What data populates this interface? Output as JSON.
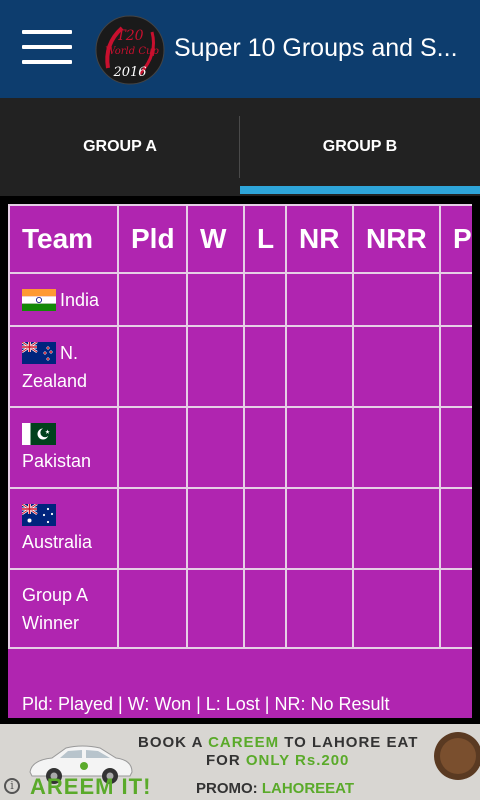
{
  "app_bar": {
    "title": "Super 10 Groups and S...",
    "logo_text": "T20 World Cup 2016"
  },
  "tabs": [
    {
      "label": "GROUP A",
      "selected": false
    },
    {
      "label": "GROUP B",
      "selected": true
    }
  ],
  "table": {
    "headers": [
      "Team",
      "Pld",
      "W",
      "L",
      "NR",
      "NRR",
      "P"
    ],
    "rows": [
      {
        "team_line1": "India",
        "team_line2": "",
        "flag": "india-flag"
      },
      {
        "team_line1": "N.",
        "team_line2": "Zealand",
        "flag": "new-zealand-flag"
      },
      {
        "team_line1": "",
        "team_line2": "Pakistan",
        "flag": "pakistan-flag"
      },
      {
        "team_line1": "",
        "team_line2": "Australia",
        "flag": "australia-flag"
      },
      {
        "team_line1": "Group A",
        "team_line2": "Winner",
        "flag": ""
      }
    ],
    "legend": "Pld: Played | W: Won | L: Lost | NR: No Result"
  },
  "ad": {
    "line1_a": "BOOK A ",
    "line1_b": "CAREEM",
    "line1_c": " TO LAHORE EAT",
    "line2_a": "FOR ",
    "line2_b": "ONLY Rs.200",
    "line3_a": "AREEM IT!",
    "line3_b": "PROMO: ",
    "line3_c": "LAHOREEAT"
  },
  "colors": {
    "app_bar": "#0d3d6e",
    "tab_bar": "#222222",
    "tab_indicator": "#2ea5d9",
    "table_bg": "#b025b0",
    "table_border": "#e6cfe6"
  }
}
